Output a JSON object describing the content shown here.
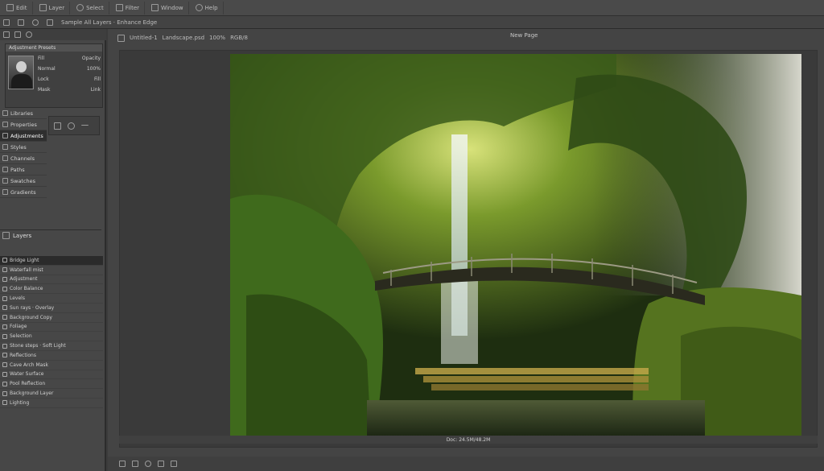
{
  "menubar": {
    "groups": [
      {
        "label": "Edit",
        "icon": "file-icon"
      },
      {
        "label": "Layer",
        "icon": "layers-icon"
      },
      {
        "label": "Select",
        "icon": "selection-icon"
      },
      {
        "label": "Filter",
        "icon": "filter-icon"
      },
      {
        "label": "Window",
        "icon": "window-icon"
      },
      {
        "label": "Help",
        "icon": "help-icon"
      }
    ],
    "options_label": "Sample All Layers · Enhance Edge"
  },
  "left_panel": {
    "preset_header": "Adjustment Presets",
    "preset_rows": [
      {
        "a": "Fill",
        "b": "Opacity"
      },
      {
        "a": "Normal",
        "b": "100%"
      },
      {
        "a": "Lock",
        "b": "Fill"
      },
      {
        "a": "Mask",
        "b": "Link"
      }
    ],
    "side_items": [
      "Libraries",
      "Properties",
      "Adjustments",
      "Styles",
      "Channels",
      "Paths",
      "Swatches",
      "Gradients"
    ],
    "layers_title": "Layers",
    "layer_rows": [
      "Bridge Light",
      "Waterfall mist",
      "Adjustment",
      "Color Balance",
      "Levels",
      "Sun rays · Overlay",
      "Background Copy",
      "Foliage",
      "Selection",
      "Stone steps · Soft Light",
      "Reflections",
      "Cave Arch Mask",
      "Water Surface",
      "Pool Reflection",
      "Background Layer",
      "Lighting"
    ]
  },
  "document": {
    "tabs": [
      "Untitled-1",
      "Landscape.psd",
      "100%",
      "RGB/8"
    ],
    "title": "New Page",
    "status": "Doc: 24.5M/48.2M",
    "artwork_description_icon": "forest-waterfall-bridge-image"
  }
}
